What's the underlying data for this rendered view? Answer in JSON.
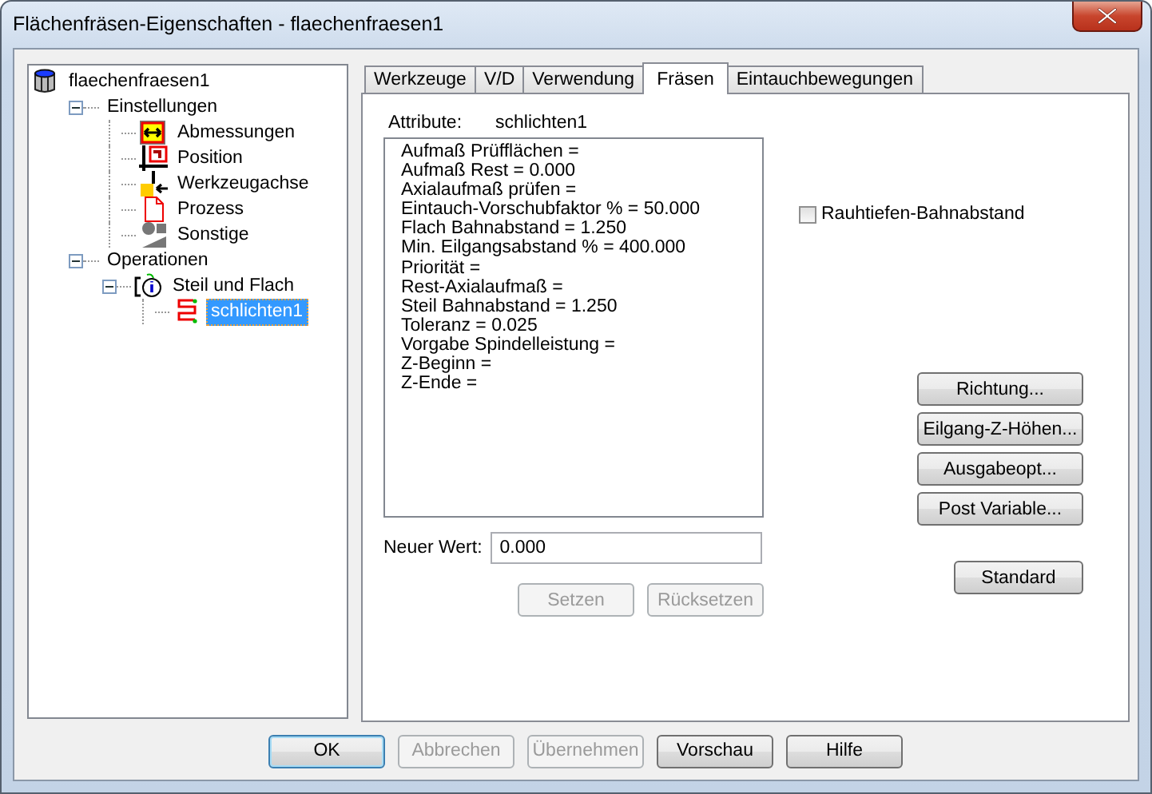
{
  "window": {
    "title": "Flächenfräsen-Eigenschaften - flaechenfraesen1"
  },
  "tree": [
    {
      "label": "flaechenfraesen1",
      "kind": "root",
      "selected": false,
      "children": [
        {
          "label": "Einstellungen",
          "kind": "group",
          "expanded": true,
          "selected": false,
          "children": [
            {
              "label": "Abmessungen",
              "kind": "dimensions",
              "selected": false
            },
            {
              "label": "Position",
              "kind": "position",
              "selected": false
            },
            {
              "label": "Werkzeugachse",
              "kind": "axis",
              "selected": false
            },
            {
              "label": "Prozess",
              "kind": "process",
              "selected": false
            },
            {
              "label": "Sonstige",
              "kind": "other",
              "selected": false
            }
          ]
        },
        {
          "label": "Operationen",
          "kind": "group",
          "expanded": true,
          "selected": false,
          "children": [
            {
              "label": "Steil und Flach",
              "kind": "operation",
              "expanded": true,
              "selected": false,
              "children": [
                {
                  "label": "schlichten1",
                  "kind": "toolpath",
                  "selected": true
                }
              ]
            }
          ]
        }
      ]
    }
  ],
  "tabs": [
    {
      "label": "Werkzeuge",
      "selected": false
    },
    {
      "label": "V/D",
      "selected": false
    },
    {
      "label": "Verwendung",
      "selected": false
    },
    {
      "label": "Fräsen",
      "selected": true
    },
    {
      "label": "Eintauchbewegungen",
      "selected": false
    }
  ],
  "attribute": {
    "label": "Attribute:",
    "value": "schlichten1"
  },
  "attribute_list": [
    "Aufmaß Prüfflächen =",
    "Aufmaß Rest = 0.000",
    "Axialaufmaß prüfen =",
    "Eintauch-Vorschubfaktor % = 50.000",
    "Flach Bahnabstand = 1.250",
    "Min. Eilgangsabstand % = 400.000",
    "Priorität =",
    "Rest-Axialaufmaß =",
    "Steil Bahnabstand = 1.250",
    "Toleranz = 0.025",
    "Vorgabe Spindelleistung =",
    "Z-Beginn =",
    "Z-Ende ="
  ],
  "new_value": {
    "label": "Neuer Wert:",
    "value": "0.000"
  },
  "value_buttons": [
    {
      "label": "Setzen",
      "disabled": true
    },
    {
      "label": "Rücksetzen",
      "disabled": true
    }
  ],
  "checkbox": {
    "label": "Rauhtiefen-Bahnabstand",
    "checked": false
  },
  "side_buttons": [
    "Richtung...",
    "Eilgang-Z-Höhen...",
    "Ausgabeopt...",
    "Post Variable..."
  ],
  "standard_button": "Standard",
  "footer_buttons": [
    {
      "label": "OK",
      "default": true,
      "disabled": false
    },
    {
      "label": "Abbrechen",
      "default": false,
      "disabled": true
    },
    {
      "label": "Übernehmen",
      "default": false,
      "disabled": true
    },
    {
      "label": "Vorschau",
      "default": false,
      "disabled": false
    },
    {
      "label": "Hilfe",
      "default": false,
      "disabled": false
    }
  ]
}
